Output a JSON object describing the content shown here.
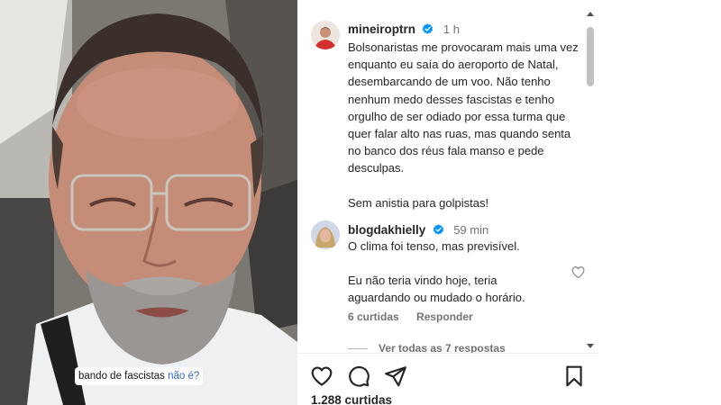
{
  "video": {
    "caption_main": "bando de fascistas",
    "caption_highlight": "não é?"
  },
  "post": {
    "username": "mineiroptrn",
    "time": "1 h",
    "paragraphs": [
      "Bolsonaristas me provocaram mais uma vez enquanto eu saía do aeroporto de Natal, desembarcando de um voo. Não tenho nenhum medo desses fascistas e tenho orgulho de ser odiado por essa turma que quer falar alto nas ruas, mas quando senta no banco dos réus fala manso e pede desculpas.",
      "Sem anistia para golpistas!"
    ]
  },
  "comment": {
    "username": "blogdakhielly",
    "time": "59 min",
    "paragraphs": [
      "O clima foi tenso, mas previsível.",
      "Eu não teria vindo hoje, teria aguardando ou mudado o horário."
    ],
    "likes_label": "6 curtidas",
    "reply_label": "Responder",
    "view_replies": "Ver todas as 7 respostas"
  },
  "footer": {
    "likes": "1.288 curtidas"
  },
  "icons": {
    "verified": "verified-badge-icon",
    "like": "heart-icon",
    "comment": "comment-bubble-icon",
    "share": "paper-plane-icon",
    "save": "bookmark-icon"
  },
  "colors": {
    "verified": "#0095f6",
    "text": "#262626",
    "muted": "#737373",
    "caption_highlight": "#2b63c9"
  }
}
